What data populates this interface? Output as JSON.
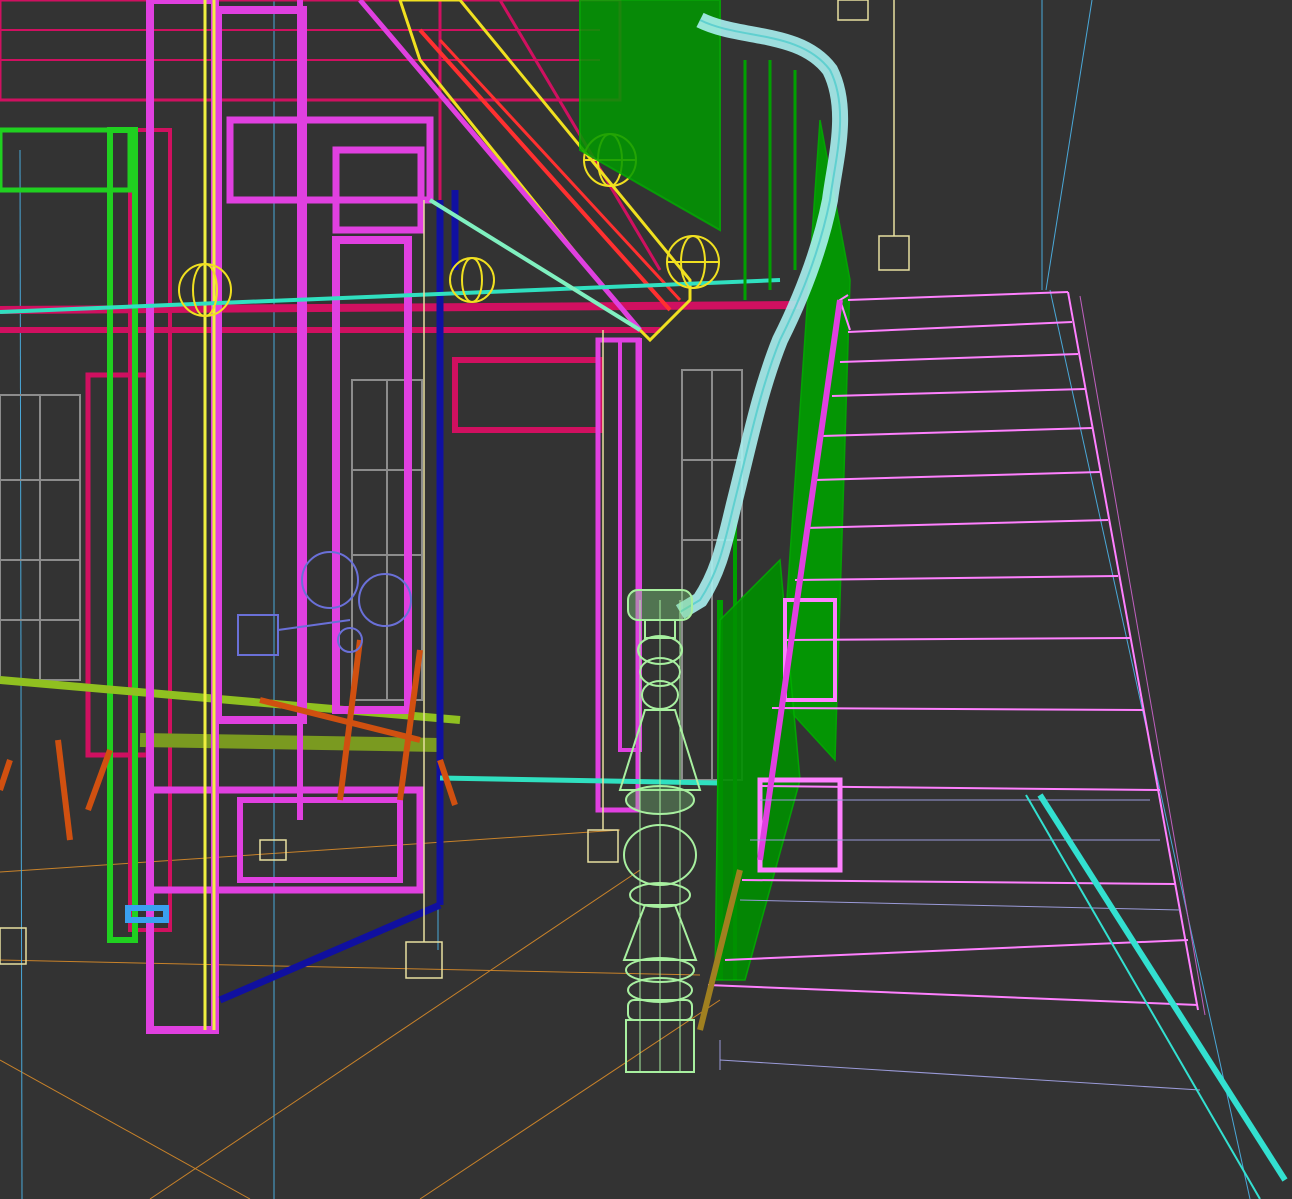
{
  "viewport": {
    "background": "#333333",
    "render_mode": "wireframe",
    "view": "perspective"
  },
  "scene": {
    "objects": [
      {
        "name": "staircase",
        "color": "#ff80ff"
      },
      {
        "name": "handrail",
        "color": "#a8f0f0"
      },
      {
        "name": "newel-post",
        "color": "#a8f0a0"
      },
      {
        "name": "balusters",
        "color": "#00a000"
      },
      {
        "name": "stair-stringer-edge",
        "color": "#33e0d0"
      },
      {
        "name": "door-frames",
        "color": "#e040e0"
      },
      {
        "name": "upper-beams",
        "color": "#d01060"
      },
      {
        "name": "cyan-ledger",
        "color": "#30e0c0"
      },
      {
        "name": "pendant-lamps",
        "color": "#f0e020"
      },
      {
        "name": "dining-chairs",
        "color": "#d05010"
      },
      {
        "name": "windows",
        "color": "#909090"
      },
      {
        "name": "navy-post",
        "color": "#1010a0"
      },
      {
        "name": "light-gizmos",
        "color": "#e8e0a0"
      },
      {
        "name": "guide-lines",
        "color": "#d08020"
      }
    ]
  }
}
